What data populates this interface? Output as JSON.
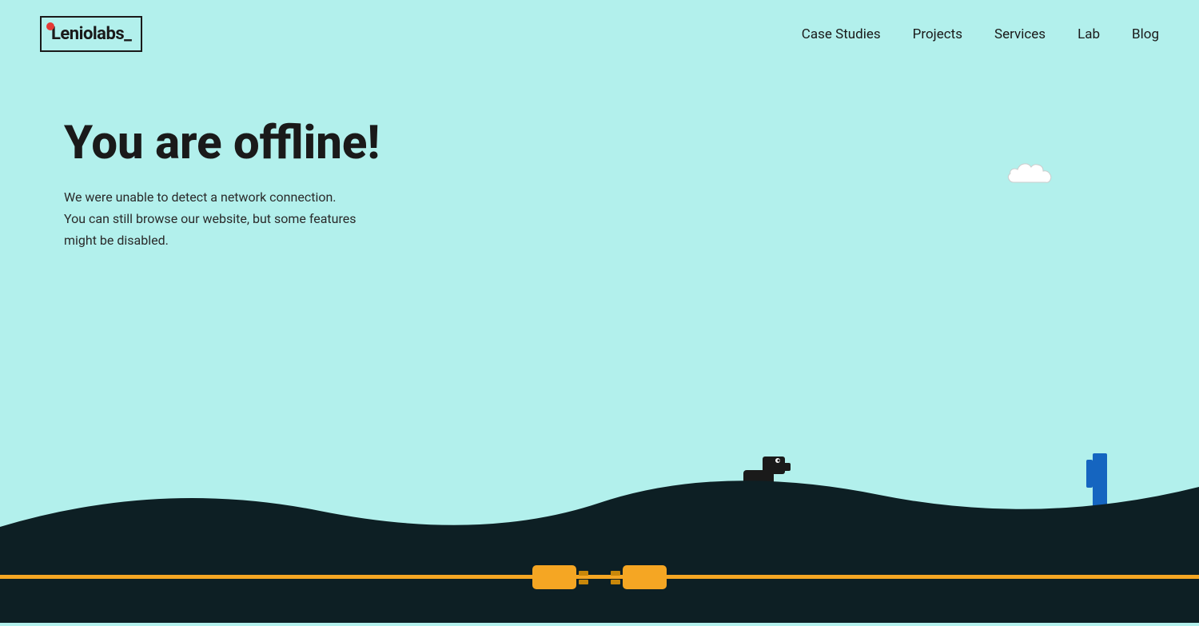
{
  "logo": {
    "text": "Leniolabs_"
  },
  "nav": {
    "items": [
      {
        "label": "Case Studies",
        "href": "#"
      },
      {
        "label": "Projects",
        "href": "#"
      },
      {
        "label": "Services",
        "href": "#"
      },
      {
        "label": "Lab",
        "href": "#"
      },
      {
        "label": "Blog",
        "href": "#"
      }
    ]
  },
  "offline": {
    "title": "You are offline!",
    "description_line1": "We were unable to detect a network connection.",
    "description_line2": "You can still browse our website, but some features",
    "description_line3": "might be disabled."
  },
  "colors": {
    "background": "#b2f0ec",
    "dark": "#0d1f24",
    "accent_yellow": "#f5a623",
    "logo_dot": "#e53935",
    "dino": "#1a1a1a",
    "barrier_blue": "#1565c0"
  }
}
